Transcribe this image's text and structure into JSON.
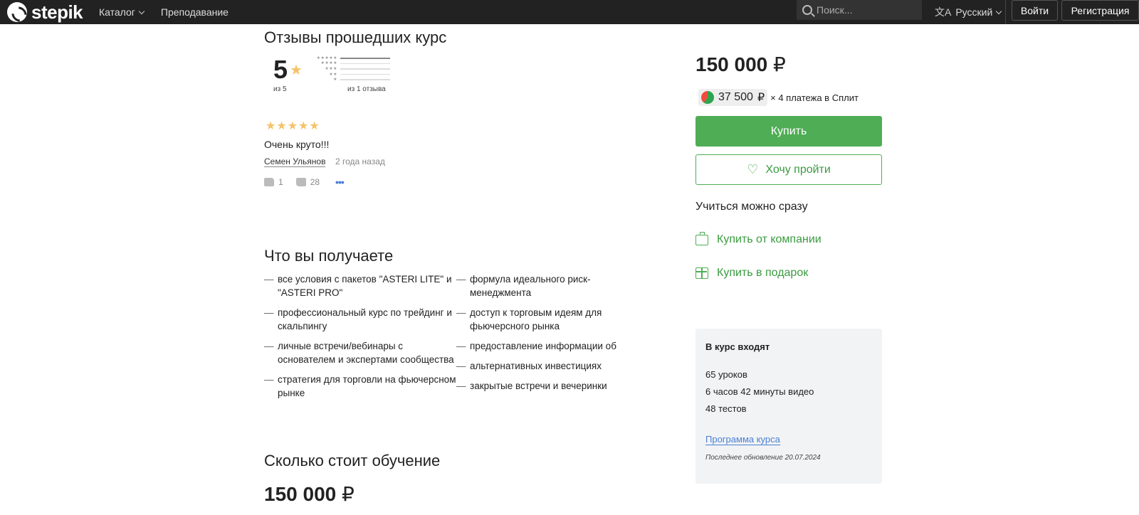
{
  "header": {
    "logo_text": "stepik",
    "nav": [
      {
        "label": "Каталог",
        "has_dropdown": true
      },
      {
        "label": "Преподавание",
        "has_dropdown": false
      }
    ],
    "search": {
      "placeholder": "Поиск..."
    },
    "language": "Русский",
    "login_label": "Войти",
    "register_label": "Регистрация"
  },
  "reviews": {
    "title": "Отзывы прошедших курс",
    "average": "5",
    "of_max": "из 5",
    "count_label": "из 1 отзыва",
    "distribution": [
      {
        "stars": "★★★★★",
        "fraction": 1
      },
      {
        "stars": "★★★★",
        "fraction": 0
      },
      {
        "stars": "★★★",
        "fraction": 0
      },
      {
        "stars": "★★",
        "fraction": 0
      },
      {
        "stars": "★",
        "fraction": 0
      }
    ],
    "items": [
      {
        "stars": "★★★★★",
        "text": "Очень круто!!!",
        "author": "Семен Ульянов",
        "date": "2 года назад",
        "likes": "1",
        "dislikes": "28"
      }
    ]
  },
  "benefits": {
    "title": "Что вы получаете",
    "left": [
      "все условия с пакетов \"ASTERI LITE\" и \"ASTERI PRO\"",
      "профессиональный курс по трейдинг и скальпингу",
      "личные встречи/вебинары с основателем и экспертами сообщества",
      "стратегия для торговли на фьючерсном рынке"
    ],
    "right": [
      "формула идеального риск-менеджмента",
      "доступ к торговым идеям для фьючерсного рынка",
      "предоставление информации об",
      "альтернативных инвестициях",
      "закрытые встречи и вечеринки"
    ]
  },
  "pricing": {
    "title": "Сколько стоит обучение",
    "price": "150 000",
    "currency": "₽"
  },
  "sidebar": {
    "price": "150 000",
    "currency": "₽",
    "split_amount": "37 500",
    "split_text": "× 4 платежа в Сплит",
    "buy_label": "Купить",
    "wish_label": "Хочу пройти",
    "learn_now": "Учиться можно сразу",
    "buy_company": "Купить от компании",
    "buy_gift": "Купить в подарок",
    "includes": {
      "title": "В курс входят",
      "lessons_count": "65",
      "lessons_label": "уроков",
      "hours": "6",
      "hours_label": "часов",
      "minutes": "42",
      "minutes_label": "минуты видео",
      "tests_count": "48",
      "tests_label": "тестов",
      "program_link": "Программа курса",
      "updated": "Последнее обновление 20.07.2024"
    }
  }
}
